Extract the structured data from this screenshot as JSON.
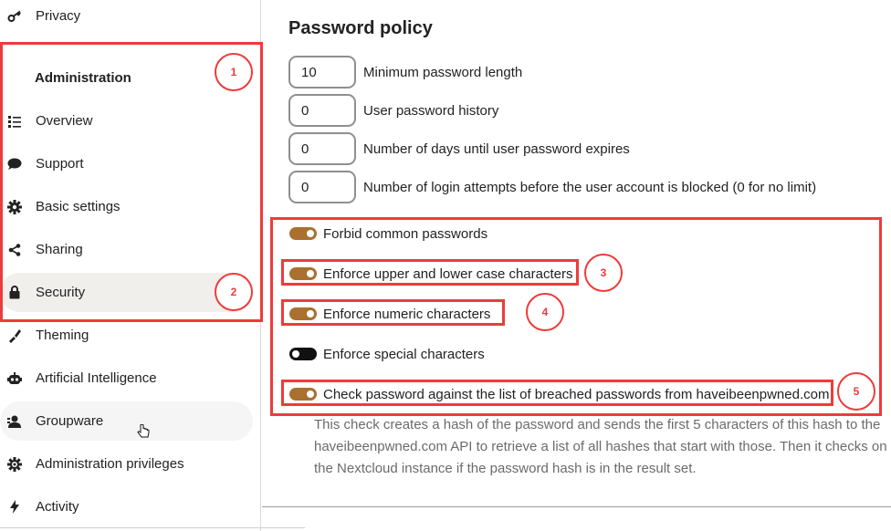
{
  "sidebar": {
    "top_item": {
      "label": "Privacy",
      "icon": "key-icon"
    },
    "section_title": "Administration",
    "items": [
      {
        "label": "Overview",
        "icon": "list-icon"
      },
      {
        "label": "Support",
        "icon": "chat-bubble-icon"
      },
      {
        "label": "Basic settings",
        "icon": "gear-icon"
      },
      {
        "label": "Sharing",
        "icon": "share-icon"
      },
      {
        "label": "Security",
        "icon": "lock-icon",
        "active": true
      },
      {
        "label": "Theming",
        "icon": "paint-brush-icon"
      },
      {
        "label": "Artificial Intelligence",
        "icon": "robot-icon"
      },
      {
        "label": "Groupware",
        "icon": "contacts-icon"
      },
      {
        "label": "Administration privileges",
        "icon": "admin-gear-icon"
      },
      {
        "label": "Activity",
        "icon": "lightning-icon"
      }
    ]
  },
  "main": {
    "title": "Password policy",
    "number_fields": [
      {
        "value": "10",
        "label": "Minimum password length"
      },
      {
        "value": "0",
        "label": "User password history"
      },
      {
        "value": "0",
        "label": "Number of days until user password expires"
      },
      {
        "value": "0",
        "label": "Number of login attempts before the user account is blocked (0 for no limit)"
      }
    ],
    "toggles": [
      {
        "label": "Forbid common passwords",
        "on": true
      },
      {
        "label": "Enforce upper and lower case characters",
        "on": true
      },
      {
        "label": "Enforce numeric characters",
        "on": true
      },
      {
        "label": "Enforce special characters",
        "on": false
      },
      {
        "label": "Check password against the list of breached passwords from haveibeenpwned.com",
        "on": true
      }
    ],
    "hint": "This check creates a hash of the password and sends the first 5 characters of this hash to the haveibeenpwned.com API to retrieve a list of all hashes that start with those. Then it checks on the Nextcloud instance if the password hash is in the result set."
  },
  "annotations": {
    "markers": [
      "1",
      "2",
      "3",
      "4",
      "5"
    ],
    "color": "#ee3b3b"
  },
  "colors": {
    "toggle_on": "#a9702f",
    "toggle_off": "#111111",
    "active_item_bg": "#f1efec"
  }
}
